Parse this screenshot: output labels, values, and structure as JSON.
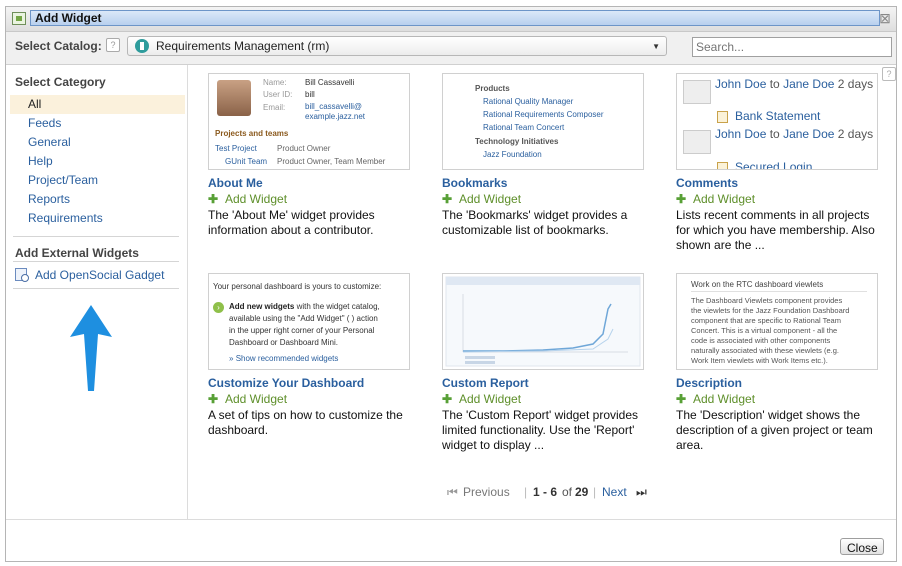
{
  "window": {
    "title": "Add Widget"
  },
  "catalog": {
    "label": "Select Catalog:",
    "help": "?",
    "selected": "Requirements Management (rm)",
    "search_placeholder": "Search..."
  },
  "sidebar": {
    "category_heading": "Select Category",
    "categories": [
      {
        "label": "All"
      },
      {
        "label": "Feeds"
      },
      {
        "label": "General"
      },
      {
        "label": "Help"
      },
      {
        "label": "Project/Team"
      },
      {
        "label": "Reports"
      },
      {
        "label": "Requirements"
      }
    ],
    "external_heading": "Add External Widgets",
    "opensocial_label": "Add OpenSocial Gadget"
  },
  "widgets": [
    {
      "name": "About Me",
      "add_label": "Add Widget",
      "description": "The 'About Me' widget provides information about a contributor.",
      "preview": {
        "name_label": "Name:",
        "name_value": "Bill Cassavelli",
        "userid_label": "User ID:",
        "userid_value": "bill",
        "email_label": "Email:",
        "email_value1": "bill_cassavelli@",
        "email_value2": "example.jazz.net",
        "projects_heading": "Projects and teams",
        "row1_link": "Test Project",
        "row1_role": "Product Owner",
        "row2_link": "GUnit Team",
        "row2_role": "Product Owner, Team Member"
      }
    },
    {
      "name": "Bookmarks",
      "add_label": "Add Widget",
      "description": "The 'Bookmarks' widget provides a customizable list of bookmarks.",
      "preview": {
        "products_heading": "Products",
        "links": [
          "Rational Quality Manager",
          "Rational Requirements Composer",
          "Rational Team Concert"
        ],
        "tech_heading": "Technology Initiatives",
        "tech_link": "Jazz Foundation"
      }
    },
    {
      "name": "Comments",
      "add_label": "Add Widget",
      "description": "Lists recent comments in all projects for which you have membership. Also shown are the ...",
      "preview": {
        "from1": "John Doe",
        "to1": "to",
        "who1": "Jane Doe",
        "time1": "2 days",
        "item1": "Bank Statement",
        "from2": "John Doe",
        "to2": "to",
        "who2": "Jane Doe",
        "time2": "2 days",
        "item2": "Secured Login"
      }
    },
    {
      "name": "Customize Your Dashboard",
      "add_label": "Add Widget",
      "description": "A set of tips on how to customize the dashboard.",
      "preview": {
        "intro": "Your personal dashboard is yours to customize:",
        "tip_bold": "Add new widgets",
        "tip_line1": "with the widget catalog,",
        "tip_line2": "available using the \"Add Widget\" (   ) action",
        "tip_line3": "in the upper right corner of your Personal",
        "tip_line4": "Dashboard or Dashboard Mini.",
        "show_more": "Show recommended widgets"
      }
    },
    {
      "name": "Custom Report",
      "add_label": "Add Widget",
      "description": "The 'Custom Report' widget provides limited functionality. Use the 'Report' widget to display ..."
    },
    {
      "name": "Description",
      "add_label": "Add Widget",
      "description": "The 'Description' widget shows the description of a given project or team area.",
      "preview": {
        "heading": "Work on the RTC dashboard viewlets",
        "lines": [
          "The Dashboard Viewlets component provides",
          "the viewlets for the Jazz Foundation Dashboard",
          "component that are specific to Rational Team",
          "Concert. This is a virtual component - all the",
          "code is associated with other components",
          "naturally associated with these viewlets (e.g.",
          "Work Item viewlets with Work Items etc.)."
        ]
      }
    }
  ],
  "pager": {
    "previous": "Previous",
    "range": "1 - 6",
    "of": "of",
    "total": "29",
    "next": "Next"
  },
  "footer": {
    "close_label": "Close"
  },
  "colors": {
    "link": "#2a5f9e",
    "add": "#5e8f2a",
    "selected_bg": "#fbf1dc",
    "annotation_arrow": "#1e8fe0"
  }
}
